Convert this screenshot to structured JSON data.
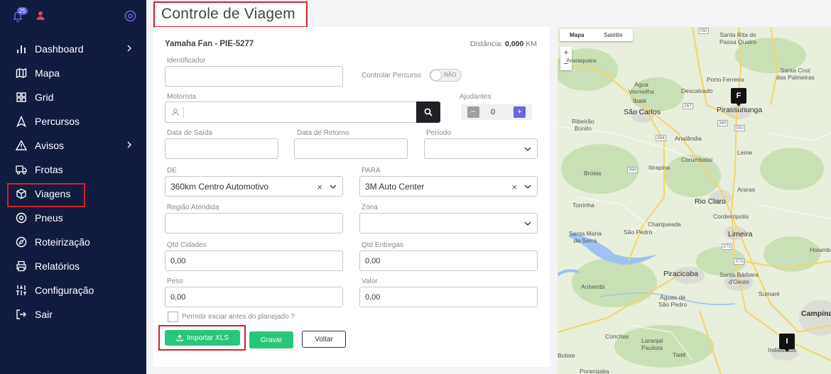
{
  "notifications": {
    "count": "25"
  },
  "sidebar": {
    "items": [
      {
        "label": "Dashboard",
        "icon": "bar-chart-icon",
        "has_submenu": true
      },
      {
        "label": "Mapa",
        "icon": "map-icon",
        "has_submenu": false
      },
      {
        "label": "Grid",
        "icon": "grid-icon",
        "has_submenu": false
      },
      {
        "label": "Percursos",
        "icon": "navigation-icon",
        "has_submenu": false
      },
      {
        "label": "Avisos",
        "icon": "warning-icon",
        "has_submenu": true
      },
      {
        "label": "Frotas",
        "icon": "truck-icon",
        "has_submenu": false
      },
      {
        "label": "Viagens",
        "icon": "package-icon",
        "has_submenu": false,
        "active": true
      },
      {
        "label": "Pneus",
        "icon": "tire-icon",
        "has_submenu": false
      },
      {
        "label": "Roteirização",
        "icon": "compass-icon",
        "has_submenu": false
      },
      {
        "label": "Relatórios",
        "icon": "printer-icon",
        "has_submenu": false
      },
      {
        "label": "Configuração",
        "icon": "sliders-icon",
        "has_submenu": false
      },
      {
        "label": "Sair",
        "icon": "logout-icon",
        "has_submenu": false
      }
    ]
  },
  "page": {
    "title": "Controle de Viagem"
  },
  "form": {
    "vehicle": "Yamaha Fan - PIE-5277",
    "distance_label": "Distância:",
    "distance_value": "0,000",
    "distance_unit": "KM",
    "identificador_label": "Identificador",
    "identificador_value": "",
    "controlar_percurso_label": "Controlar Percurso",
    "controlar_percurso_state": "NÃO",
    "motorista_label": "Motorista",
    "motorista_value": "",
    "ajudantes_label": "Ajudantes",
    "ajudantes_value": "0",
    "data_saida_label": "Data de Saída",
    "data_retorno_label": "Data de Retorno",
    "periodo_label": "Período",
    "de_label": "DE",
    "de_value": "360km Centro Automotivo",
    "para_label": "PARA",
    "para_value": "3M Auto Center",
    "regiao_label": "Região Atendida",
    "zona_label": "Zona",
    "qtd_cidades_label": "Qtd Cidades",
    "qtd_cidades_value": "0,00",
    "qtd_entregas_label": "Qtd Entregas",
    "qtd_entregas_value": "0,00",
    "peso_label": "Peso",
    "peso_value": "0,00",
    "valor_label": "Valor",
    "valor_value": "0,00",
    "permitir_label": "Permitir iniciar antes do planejado ?",
    "import_label": "Importar XLS",
    "save_label": "Gravar",
    "back_label": "Voltar"
  },
  "map": {
    "tab_map": "Mapa",
    "tab_satellite": "Satélite",
    "zoom_in": "+",
    "zoom_out": "−",
    "pin_final": "F",
    "pin_initial": "I",
    "cities": [
      "Santa Rita do Passa Quatro",
      "Araraquara",
      "Porto Ferreira",
      "Santa Cruz das Palmeiras",
      "Água Vermelha",
      "Descalvado",
      "Ibaté",
      "São Carlos",
      "Pirassununga",
      "Ribeirão Bonito",
      "Analândia",
      "Corumbataí",
      "Leme",
      "Itirapina",
      "Brotas",
      "Araras",
      "Torrinha",
      "Rio Claro",
      "Cordeirópolis",
      "Charqueada",
      "Santa Maria da Serra",
      "São Pedro",
      "Limeira",
      "Holambra",
      "Piracicaba",
      "Santa Bárbara d'Oeste",
      "Anhembi",
      "Águas de São Pedro",
      "Sumaré",
      "Campinas",
      "Conchas",
      "Laranjal Paulista",
      "Tietê",
      "Indaiatuba",
      "Bofete",
      "Porangaba"
    ],
    "roads": [
      "050",
      "267",
      "369",
      "050",
      "364",
      "369",
      "373",
      "373"
    ]
  },
  "colors": {
    "sidebar_bg": "#121c3f",
    "accent_green": "#28c67a",
    "highlight_red": "#d32128",
    "stepper_plus": "#6b63e0"
  }
}
